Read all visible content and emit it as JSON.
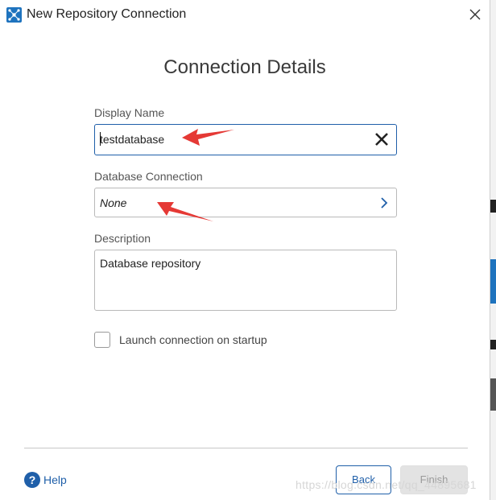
{
  "window": {
    "title": "New Repository Connection"
  },
  "page": {
    "heading": "Connection Details"
  },
  "form": {
    "display_name": {
      "label": "Display Name",
      "value": "testdatabase"
    },
    "database_connection": {
      "label": "Database Connection",
      "value": "None"
    },
    "description": {
      "label": "Description",
      "value": "Database repository"
    },
    "launch_on_startup": {
      "label": "Launch connection on startup",
      "checked": false
    }
  },
  "footer": {
    "help_label": "Help",
    "back_label": "Back",
    "finish_label": "Finish",
    "finish_enabled": false
  },
  "watermark": "https://blog.csdn.net/qq_44895681",
  "colors": {
    "accent": "#1f5fa9",
    "annotation_arrow": "#e53935",
    "app_icon": "#1e73be"
  },
  "icons": {
    "app": "repository-app-icon",
    "close": "close-icon",
    "clear": "clear-x-icon",
    "chevron": "chevron-right-icon",
    "help": "help-icon"
  }
}
